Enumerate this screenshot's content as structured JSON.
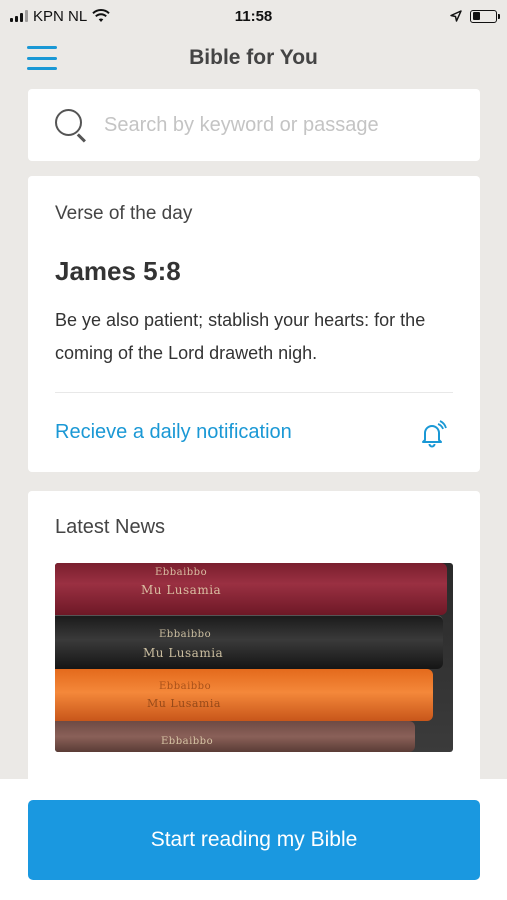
{
  "status_bar": {
    "carrier": "KPN NL",
    "time": "11:58"
  },
  "header": {
    "title": "Bible for You"
  },
  "search": {
    "placeholder": "Search by keyword or passage"
  },
  "verse_of_day": {
    "label": "Verse of the day",
    "reference": "James 5:8",
    "text": "Be ye also patient; stablish your hearts: for the coming of the Lord draweth nigh.",
    "notification_link": "Recieve a daily notification"
  },
  "news": {
    "label": "Latest News",
    "image_books": [
      {
        "title": "Ebbaibbo",
        "subtitle": "Mu Lusamia"
      },
      {
        "title": "Ebbaibbo",
        "subtitle": "Mu Lusamia"
      },
      {
        "title": "Ebbaibbo",
        "subtitle": "Mu Lusamia"
      },
      {
        "title": "Ebbaibbo",
        "subtitle": ""
      }
    ]
  },
  "cta": {
    "label": "Start reading my Bible"
  },
  "colors": {
    "accent": "#1a98d5",
    "button": "#1a98e0",
    "background": "#ebe9e6"
  }
}
